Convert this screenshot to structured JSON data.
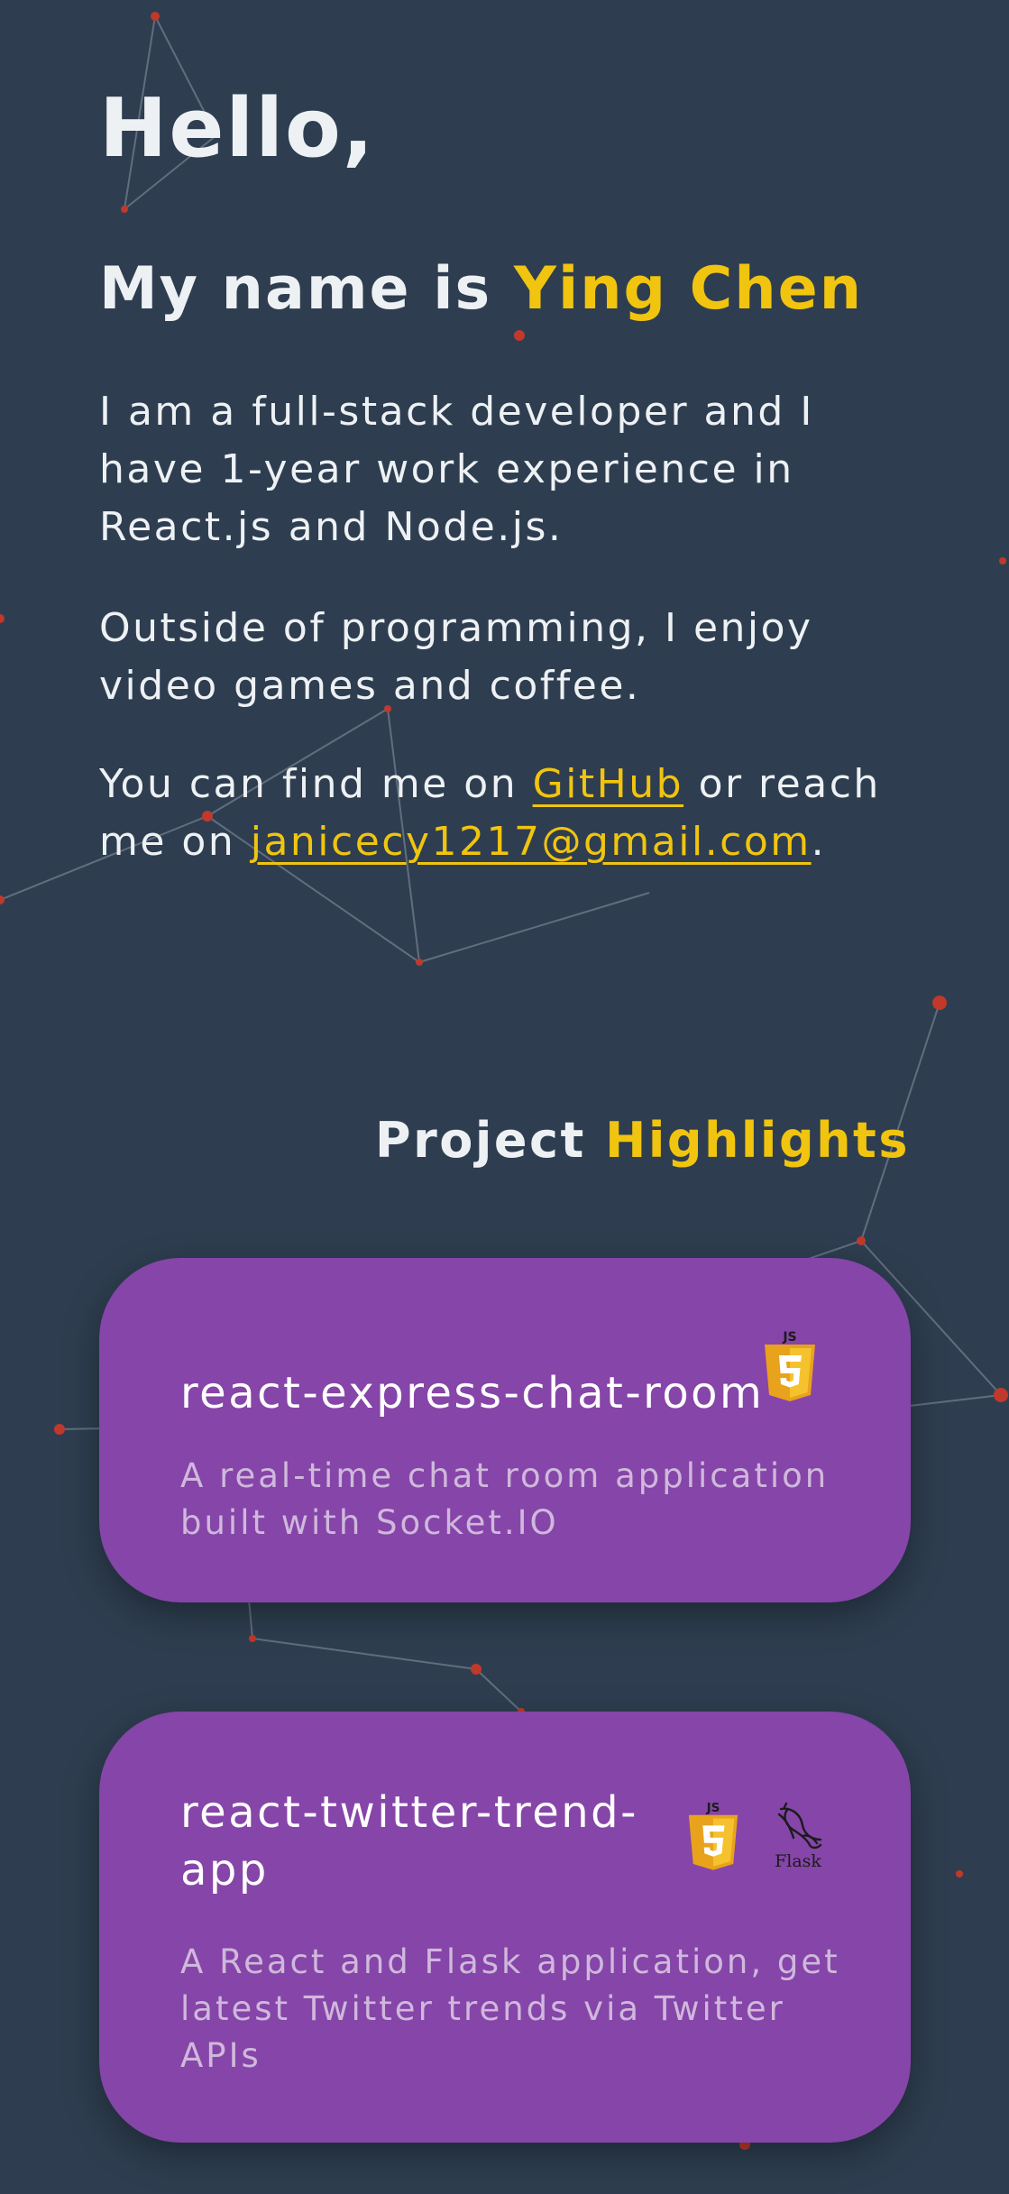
{
  "intro": {
    "greeting": "Hello,",
    "name_prefix": "My name is ",
    "name": "Ying Chen",
    "bio_paragraph_1": "I am a full-stack developer and I have 1-year work experience in React.js and Node.js.",
    "bio_paragraph_2": "Outside of programming, I enjoy video games and coffee.",
    "contact_prefix": "You can find me on ",
    "github_link": "GitHub",
    "contact_middle": " or reach me on ",
    "email_link": "janicecy1217@gmail.com",
    "contact_suffix": "."
  },
  "projects_section": {
    "title_prefix": "Project ",
    "title_accent": "Highlights"
  },
  "projects": [
    {
      "name": "react-express-chat-room",
      "description": "A real-time chat room application built with Socket.IO",
      "tech_icons": [
        "javascript-icon"
      ]
    },
    {
      "name": "react-twitter-trend-app",
      "description": "A React and Flask application, get latest Twitter trends via Twitter APIs",
      "tech_icons": [
        "javascript-icon",
        "flask-icon"
      ],
      "flask_label": "Flask"
    }
  ],
  "colors": {
    "background": "#2e3e50",
    "accent": "#f1c40f",
    "card": "#8645a8",
    "text": "#eef1f4",
    "network_node": "#c0392b"
  }
}
